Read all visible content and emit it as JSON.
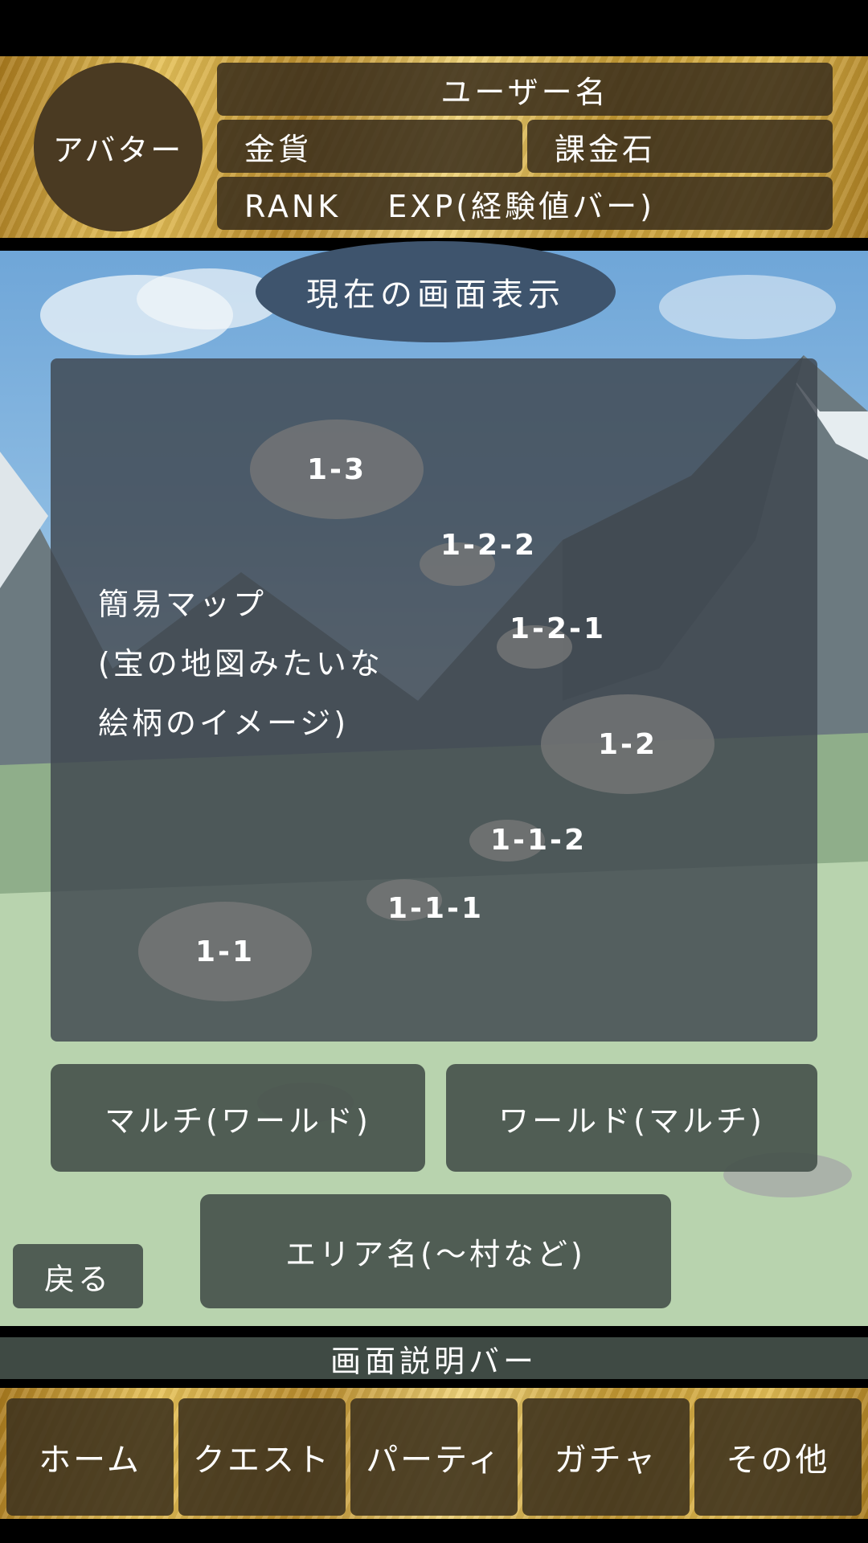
{
  "header": {
    "avatar_label": "アバター",
    "username": "ユーザー名",
    "gold": "金貨",
    "premium_stone": "課金石",
    "rank_exp": "RANK　 EXP(経験値バー)"
  },
  "screen_title": "現在の画面表示",
  "map": {
    "note_line1": "簡易マップ",
    "note_line2": "(宝の地図みたいな",
    "note_line3": "絵柄のイメージ)",
    "nodes": {
      "n1_3": "1-3",
      "n1_2_2": "1-2-2",
      "n1_2_1": "1-2-1",
      "n1_2": "1-2",
      "n1_1_2": "1-1-2",
      "n1_1_1": "1-1-1",
      "n1_1": "1-1"
    }
  },
  "buttons": {
    "multi_world": "マルチ(ワールド)",
    "world_multi": "ワールド(マルチ)",
    "area_name": "エリア名(～村など)",
    "back": "戻る"
  },
  "description_bar": "画面説明バー",
  "nav": {
    "home": "ホーム",
    "quest": "クエスト",
    "party": "パーティ",
    "gacha": "ガチャ",
    "other": "その他"
  },
  "colors": {
    "gold_bar": "#d6b04a",
    "dark_brown": "#4a3a22",
    "title_blue": "#3e546d",
    "panel_gray": "#3e464e",
    "button_green": "#46524c"
  }
}
